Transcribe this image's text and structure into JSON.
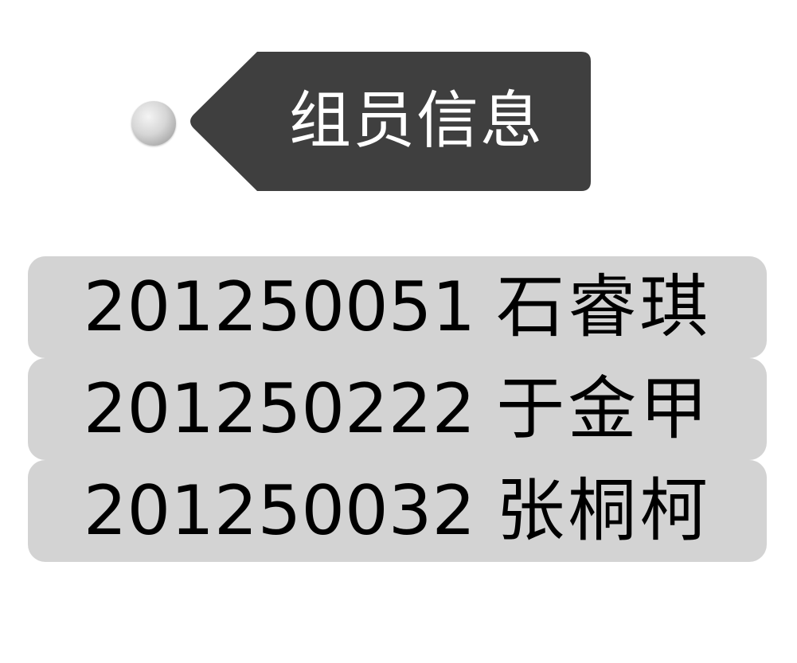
{
  "tag": {
    "label": "组员信息",
    "background_color": "#3f3f3f",
    "text_color": "#ffffff"
  },
  "members": [
    {
      "id": "201250051",
      "name": "石睿琪"
    },
    {
      "id": "201250222",
      "name": "于金甲"
    },
    {
      "id": "201250032",
      "name": "张桐柯"
    }
  ],
  "row_background_color": "#d3d3d3"
}
